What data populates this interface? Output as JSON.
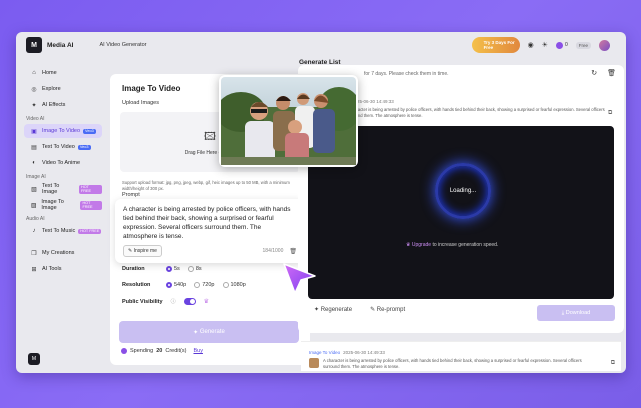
{
  "app": {
    "logo_text": "M",
    "name": "Media AI",
    "tool": "AI Video Generator"
  },
  "topbar": {
    "promo": "Try 3 Days For Free",
    "credits": "0",
    "free_label": "Free"
  },
  "sidebar": {
    "items": [
      {
        "label": "Home",
        "icon": "home-icon"
      },
      {
        "label": "Explore",
        "icon": "compass-icon"
      },
      {
        "label": "AI Effects",
        "icon": "sparkle-icon"
      }
    ],
    "video_section": "Video AI",
    "video_items": [
      {
        "label": "Image To Video",
        "badge": "Veo3"
      },
      {
        "label": "Text To Video",
        "badge": "Veo3"
      },
      {
        "label": "Video To Anime",
        "badge": ""
      }
    ],
    "image_section": "Image AI",
    "image_items": [
      {
        "label": "Text To Image",
        "badge": "HOT FREE"
      },
      {
        "label": "Image To Image",
        "badge": "HOT FREE"
      }
    ],
    "audio_section": "Audio AI",
    "audio_items": [
      {
        "label": "Text To Music",
        "badge": "HOT FREE"
      }
    ],
    "other_items": [
      {
        "label": "My Creations"
      },
      {
        "label": "AI Tools"
      }
    ],
    "bottom_logo": "M"
  },
  "left_panel": {
    "title": "Image To Video",
    "upload_label": "Upload Images",
    "upload_text": "Drag File Here or Click",
    "support_text": "Support upload format: jpg, png, jpeg, webp, gif, heic images up to 50 MB, with a minimum width/height of 300 px.",
    "prompt_label": "Prompt",
    "prompt_value": "A character is being arrested by police officers, with hands tied behind their back, showing a surprised or fearful expression. Several officers surround them. The atmosphere is tense.",
    "inspire_label": "Inspire me",
    "char_count": "184/1000",
    "duration_label": "Duration",
    "duration_options": [
      "5s",
      "8s"
    ],
    "duration_selected": "5s",
    "resolution_label": "Resolution",
    "resolution_options": [
      "540p",
      "720p",
      "1080p"
    ],
    "resolution_selected": "540p",
    "visibility_label": "Public Visibility",
    "visibility_on": true,
    "generate_label": "Generate",
    "spend_prefix": "Spending",
    "spend_amount": "20",
    "spend_suffix": "Credit(s)",
    "buy_label": "Buy"
  },
  "right_panel": {
    "title": "Generate List",
    "note": "for 7 days. Please check them in time.",
    "job_time": "2025-06-30 14:49:33",
    "job_text": "A character is being arrested by police officers, with hands tied behind their back, showing a surprised or fearful expression. Several officers surround them. The atmosphere is tense.",
    "loading": "Loading...",
    "upgrade_link": "Upgrade",
    "upgrade_rest": "to increase generation speed.",
    "regenerate": "Regenerate",
    "reprompt": "Re-prompt",
    "download": "Download",
    "second_tag": "Image To Video",
    "second_time": "2025-06-30 14:49:33",
    "second_text": "A character is being arrested by police officers, with hands tied behind their back, showing a surprised or fearful expression. Several officers surround them. The atmosphere is tense."
  },
  "colors": {
    "accent": "#6a43e0",
    "bg": "#7b5cf0"
  }
}
